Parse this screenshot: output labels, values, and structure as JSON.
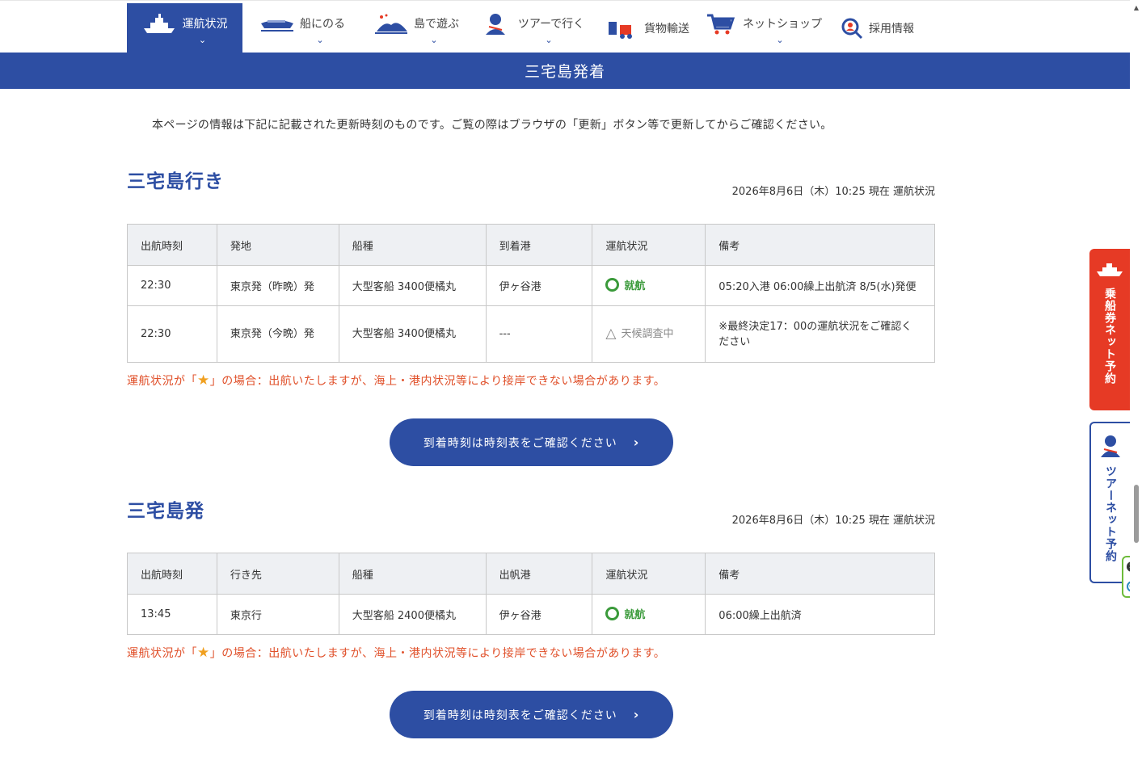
{
  "nav": {
    "items": [
      {
        "label": "運航状況",
        "icon": "ship-icon",
        "active": true
      },
      {
        "label": "船にのる",
        "icon": "boat-icon"
      },
      {
        "label": "島で遊ぶ",
        "icon": "island-icon"
      },
      {
        "label": "ツアーで行く",
        "icon": "tour-guide-icon"
      },
      {
        "label": "貨物輸送",
        "icon": "cargo-forklift-icon"
      },
      {
        "label": "ネットショップ",
        "icon": "cart-icon"
      },
      {
        "label": "採用情報",
        "icon": "recruit-search-icon"
      }
    ],
    "chevron": "⌄"
  },
  "banner": {
    "title": "三宅島発着"
  },
  "notice": "本ページの情報は下記に記載された更新時刻のものです。ご覧の際はブラウザの「更新」ボタン等で更新してからご確認ください。",
  "sections": [
    {
      "title": "三宅島行き",
      "timestamp": "2026年8月6日（木）10:25 現在 運航状況",
      "headers": [
        "出航時刻",
        "発地",
        "船種",
        "到着港",
        "運航状況",
        "備考"
      ],
      "rows": [
        {
          "time": "22:30",
          "place": "東京発（昨晩）発",
          "ship": "大型客船 3400便橘丸",
          "port": "伊ヶ谷港",
          "status": "就航",
          "status_type": "ok",
          "note": "05:20入港 06:00繰上出航済 8/5(水)発便"
        },
        {
          "time": "22:30",
          "place": "東京発（今晩）発",
          "ship": "大型客船 3400便橘丸",
          "port": "---",
          "status": "天候調査中",
          "status_type": "warn",
          "note": "※最終決定17：00の運航状況をご確認ください"
        }
      ],
      "caution_pre": "運航状況が「",
      "caution_post": "」の場合：出航いたしますが、海上・港内状況等により接岸できない場合があります。",
      "button": "到着時刻は時刻表をご確認ください"
    },
    {
      "title": "三宅島発",
      "timestamp": "2026年8月6日（木）10:25 現在 運航状況",
      "headers": [
        "出航時刻",
        "行き先",
        "船種",
        "出帆港",
        "運航状況",
        "備考"
      ],
      "rows": [
        {
          "time": "13:45",
          "place": "東京行",
          "ship": "大型客船 2400便橘丸",
          "port": "伊ヶ谷港",
          "status": "就航",
          "status_type": "ok",
          "note": "06:00繰上出航済"
        }
      ],
      "caution_pre": "運航状況が「",
      "caution_post": "」の場合：出航いたしますが、海上・港内状況等により接岸できない場合があります。",
      "button": "到着時刻は時刻表をご確認ください"
    }
  ],
  "side": {
    "ticket": "乗船券ネット予約",
    "tour": "ツアーネット予約"
  },
  "colors": {
    "brand": "#2d4ea3",
    "ticket_red": "#e63a25",
    "ok_green": "#3a9a3a",
    "caution": "#e0502a"
  }
}
